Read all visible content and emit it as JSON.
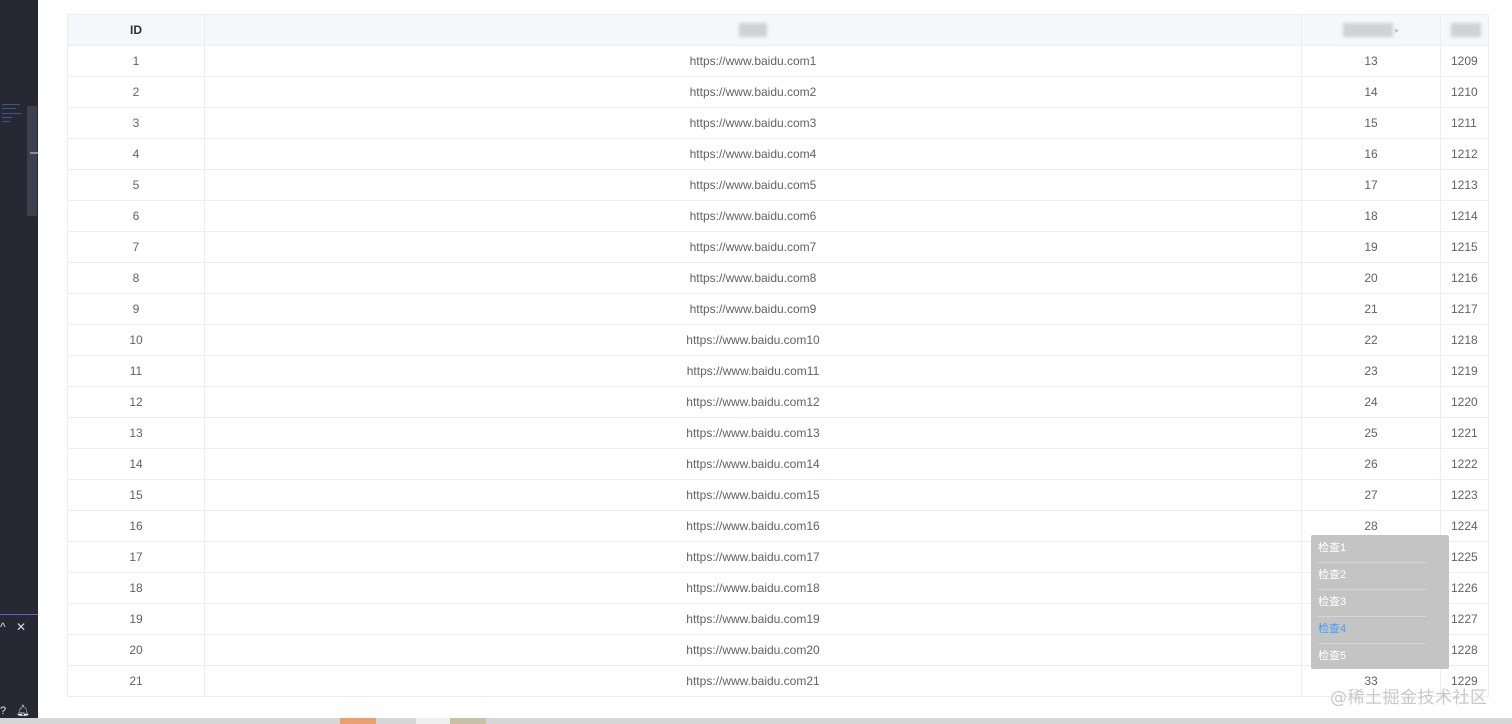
{
  "table": {
    "headers": {
      "id": "ID"
    },
    "rows": [
      {
        "id": "1",
        "url": "https://www.baidu.com1",
        "a": "13",
        "b": "1209"
      },
      {
        "id": "2",
        "url": "https://www.baidu.com2",
        "a": "14",
        "b": "1210"
      },
      {
        "id": "3",
        "url": "https://www.baidu.com3",
        "a": "15",
        "b": "1211"
      },
      {
        "id": "4",
        "url": "https://www.baidu.com4",
        "a": "16",
        "b": "1212"
      },
      {
        "id": "5",
        "url": "https://www.baidu.com5",
        "a": "17",
        "b": "1213"
      },
      {
        "id": "6",
        "url": "https://www.baidu.com6",
        "a": "18",
        "b": "1214"
      },
      {
        "id": "7",
        "url": "https://www.baidu.com7",
        "a": "19",
        "b": "1215"
      },
      {
        "id": "8",
        "url": "https://www.baidu.com8",
        "a": "20",
        "b": "1216"
      },
      {
        "id": "9",
        "url": "https://www.baidu.com9",
        "a": "21",
        "b": "1217"
      },
      {
        "id": "10",
        "url": "https://www.baidu.com10",
        "a": "22",
        "b": "1218"
      },
      {
        "id": "11",
        "url": "https://www.baidu.com11",
        "a": "23",
        "b": "1219"
      },
      {
        "id": "12",
        "url": "https://www.baidu.com12",
        "a": "24",
        "b": "1220"
      },
      {
        "id": "13",
        "url": "https://www.baidu.com13",
        "a": "25",
        "b": "1221"
      },
      {
        "id": "14",
        "url": "https://www.baidu.com14",
        "a": "26",
        "b": "1222"
      },
      {
        "id": "15",
        "url": "https://www.baidu.com15",
        "a": "27",
        "b": "1223"
      },
      {
        "id": "16",
        "url": "https://www.baidu.com16",
        "a": "28",
        "b": "1224"
      },
      {
        "id": "17",
        "url": "https://www.baidu.com17",
        "a": "",
        "b": "1225"
      },
      {
        "id": "18",
        "url": "https://www.baidu.com18",
        "a": "",
        "b": "1226"
      },
      {
        "id": "19",
        "url": "https://www.baidu.com19",
        "a": "",
        "b": "1227"
      },
      {
        "id": "20",
        "url": "https://www.baidu.com20",
        "a": "",
        "b": "1228"
      },
      {
        "id": "21",
        "url": "https://www.baidu.com21",
        "a": "33",
        "b": "1229"
      }
    ]
  },
  "dropdown": {
    "items": [
      "检查1",
      "检查2",
      "检查3",
      "检查4",
      "检查5"
    ],
    "active_index": 3,
    "active_color": "#409eff"
  },
  "watermark": "@稀土掘金技术社区",
  "left_panel": {
    "controls": [
      "^",
      "✕"
    ],
    "bottom_icons": [
      "?",
      "bell-icon"
    ]
  }
}
